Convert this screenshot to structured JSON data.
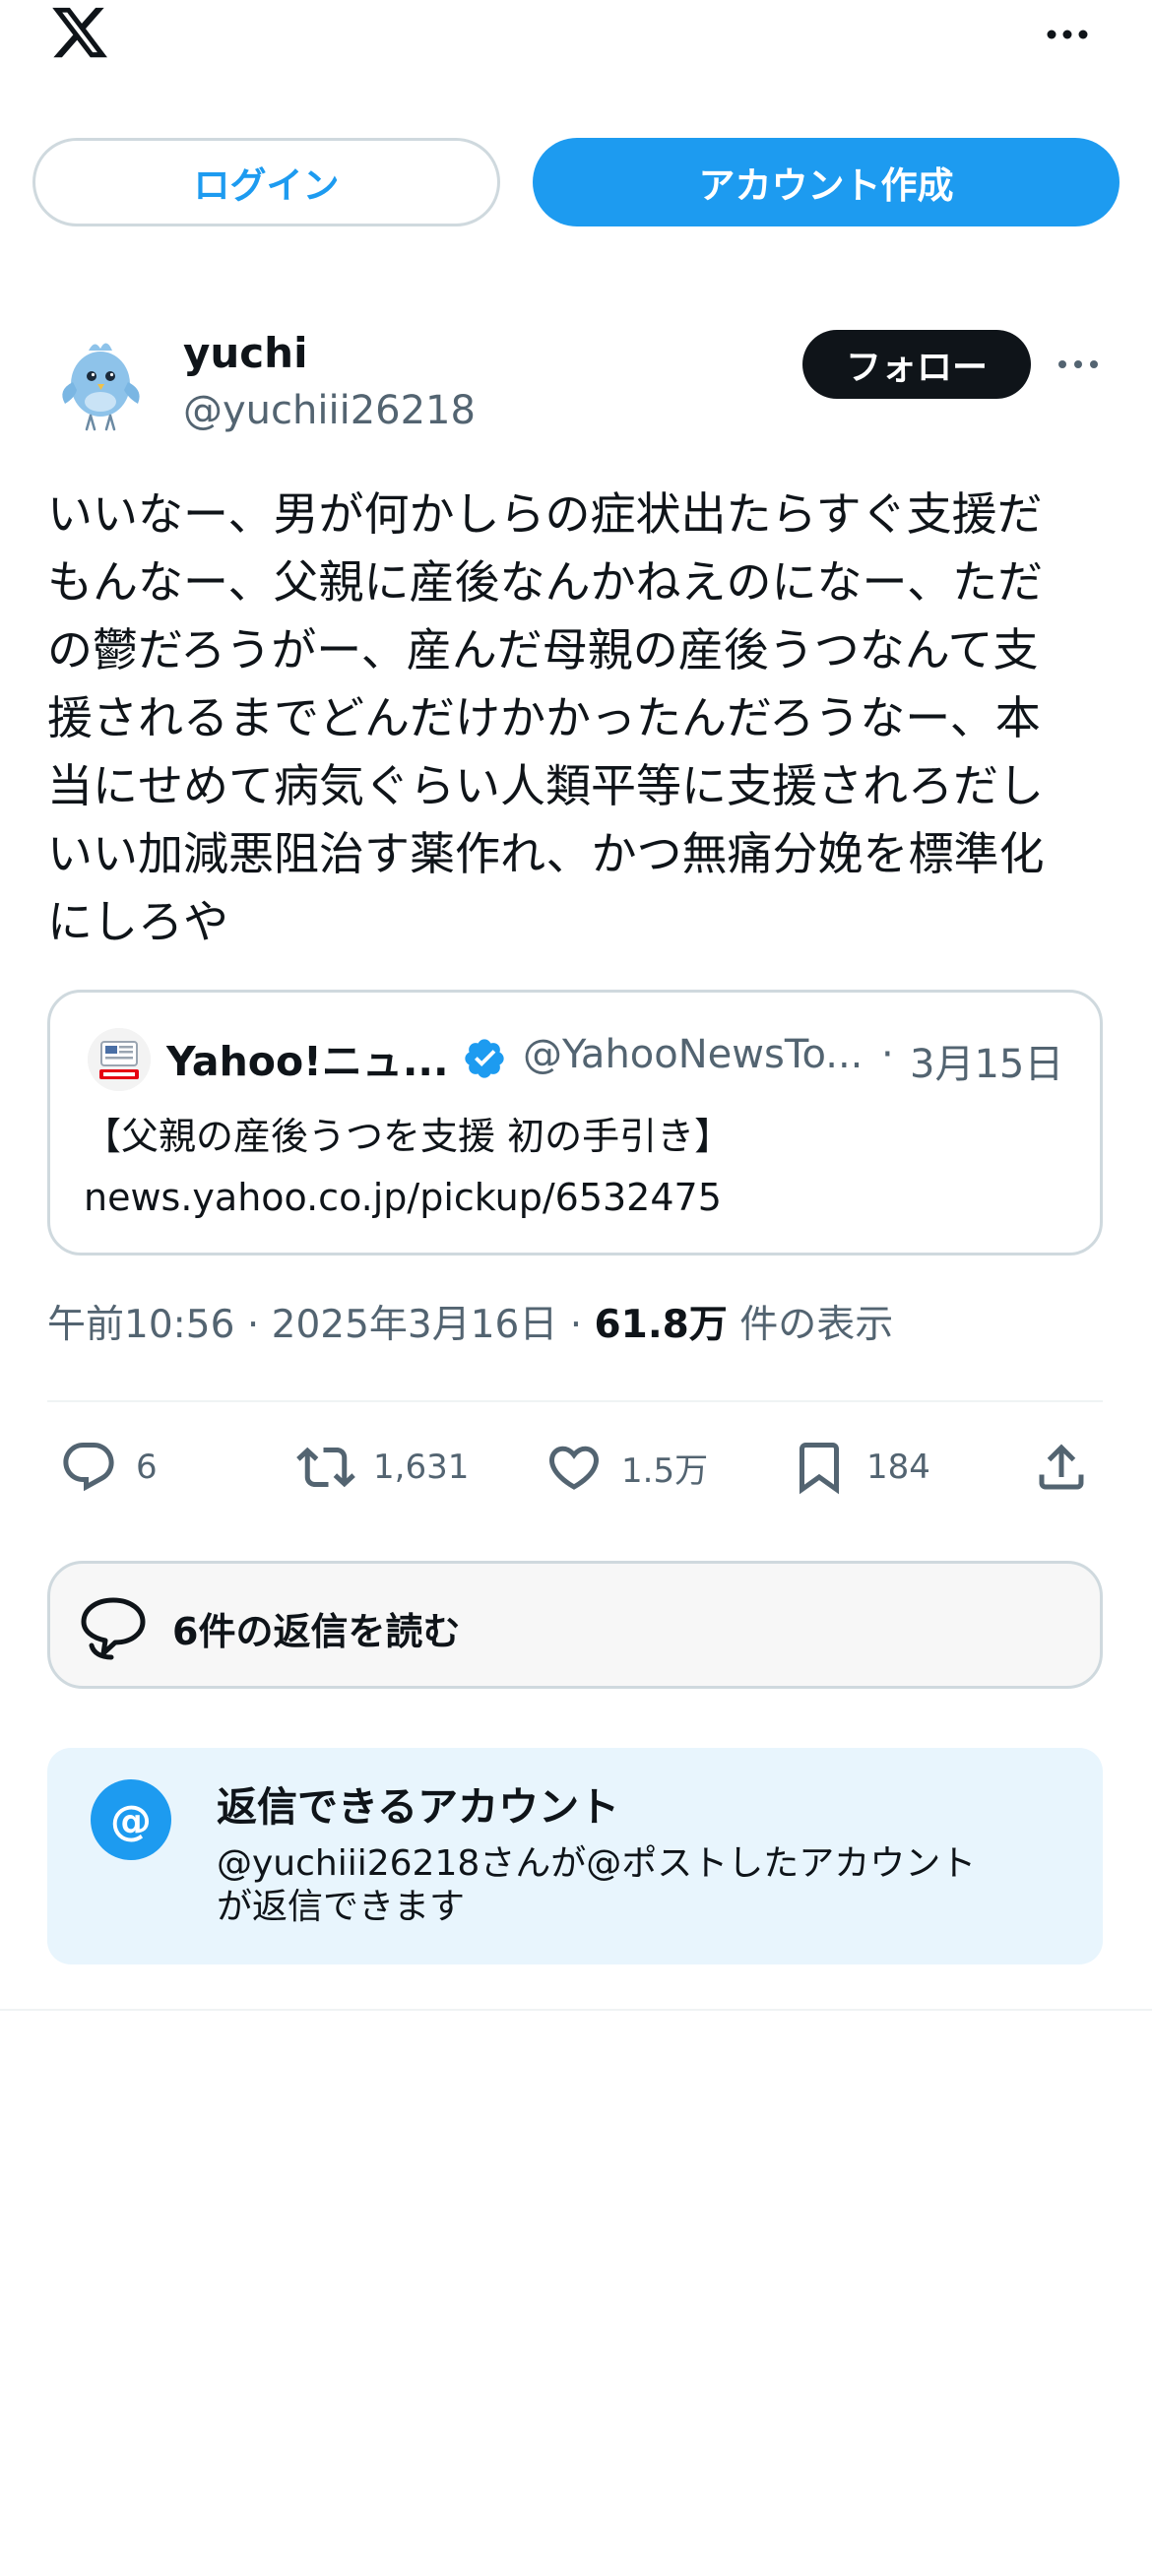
{
  "topbar": {
    "logo_icon": "x-logo-icon",
    "more_icon": "more-horizontal-icon"
  },
  "auth": {
    "login_label": "ログイン",
    "signup_label": "アカウント作成"
  },
  "post": {
    "author": {
      "display_name": "yuchi",
      "handle": "@yuchiii26218",
      "follow_label": "フォロー"
    },
    "text": "いいなー、男が何かしらの症状出たらすぐ支援だ\nもんなー、父親に産後なんかねえのになー、ただ\nの鬱だろうがー、産んだ母親の産後うつなんて支\n援されるまでどんだけかかったんだろうなー、本\n当にせめて病気ぐらい人類平等に支援されろだし\nいい加減悪阻治す薬作れ、かつ無痛分娩を標準化\nにしろや",
    "quote": {
      "name": "Yahoo!ニュ...",
      "handle": "@YahooNewsTo...",
      "separator": "·",
      "date": "3月15日",
      "body_line1": "【父親の産後うつを支援 初の手引き】",
      "body_line2": "news.yahoo.co.jp/pickup/6532475"
    },
    "meta": {
      "time": "午前10:56",
      "separator1": "·",
      "date": "2025年3月16日",
      "separator2": "·",
      "views_count": "61.8万",
      "views_label": "件の表示"
    },
    "actions": {
      "replies": "6",
      "retweets": "1,631",
      "likes": "1.5万",
      "bookmarks": "184"
    }
  },
  "read_replies_label": "6件の返信を読む",
  "who_can_reply": {
    "title": "返信できるアカウント",
    "description": "@yuchiii26218さんが@ポストしたアカウント\nが返信できます",
    "icon_text": "@"
  },
  "colors": {
    "accent": "#1d9bf0",
    "text_primary": "#0f1419",
    "text_secondary": "#536471",
    "border": "#cfd9de",
    "info_bg": "#e8f5fd"
  }
}
